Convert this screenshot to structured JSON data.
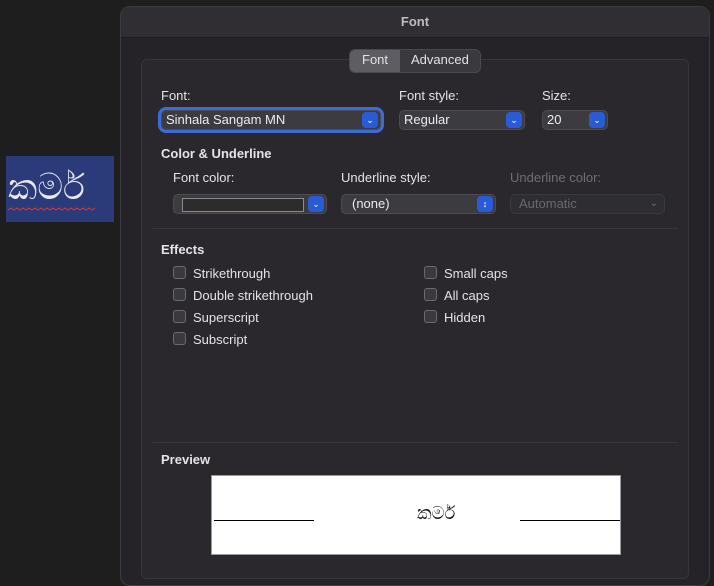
{
  "document": {
    "sample_text": "කර්ම"
  },
  "window": {
    "title": "Font"
  },
  "tabs": [
    {
      "label": "Font",
      "active": true
    },
    {
      "label": "Advanced",
      "active": false
    }
  ],
  "font_section": {
    "font_label": "Font:",
    "font_value": "Sinhala Sangam MN",
    "style_label": "Font style:",
    "style_value": "Regular",
    "size_label": "Size:",
    "size_value": "20"
  },
  "color_section": {
    "heading": "Color & Underline",
    "font_color_label": "Font color:",
    "font_color_value": "#2c2c2c",
    "underline_style_label": "Underline style:",
    "underline_style_value": "(none)",
    "underline_color_label": "Underline color:",
    "underline_color_value": "Automatic"
  },
  "effects": {
    "heading": "Effects",
    "left": [
      {
        "label": "Strikethrough",
        "checked": false
      },
      {
        "label": "Double strikethrough",
        "checked": false
      },
      {
        "label": "Superscript",
        "checked": false
      },
      {
        "label": "Subscript",
        "checked": false
      }
    ],
    "right": [
      {
        "label": "Small caps",
        "checked": false
      },
      {
        "label": "All caps",
        "checked": false
      },
      {
        "label": "Hidden",
        "checked": false
      }
    ]
  },
  "preview": {
    "heading": "Preview",
    "text": "කර්ම"
  },
  "icons": {
    "popup_arrow": "chevron-down-icon",
    "stepper_arrow": "up-down-chevron-icon"
  },
  "colors": {
    "accent": "#2a5bd6",
    "selection": "#2b3a78"
  }
}
